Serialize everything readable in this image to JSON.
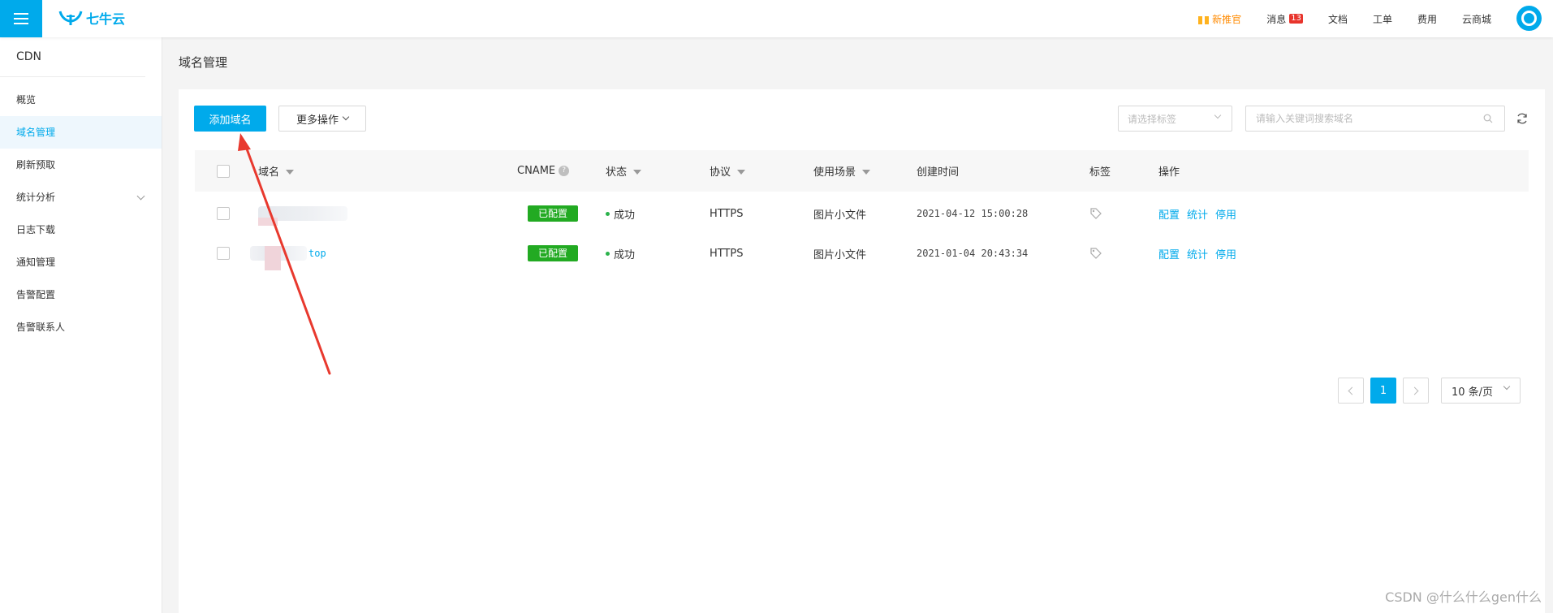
{
  "header": {
    "logo_text": "七牛云",
    "nav": [
      {
        "label": "新推官",
        "icon": "gift-icon"
      },
      {
        "label": "消息",
        "badge": "13"
      },
      {
        "label": "文档"
      },
      {
        "label": "工单"
      },
      {
        "label": "费用"
      },
      {
        "label": "云商城"
      }
    ]
  },
  "sidebar": {
    "title": "CDN",
    "items": [
      {
        "label": "概览"
      },
      {
        "label": "域名管理",
        "active": true
      },
      {
        "label": "刷新预取"
      },
      {
        "label": "统计分析",
        "expandable": true
      },
      {
        "label": "日志下载"
      },
      {
        "label": "通知管理"
      },
      {
        "label": "告警配置"
      },
      {
        "label": "告警联系人"
      }
    ]
  },
  "main": {
    "page_title": "域名管理",
    "toolbar": {
      "add_label": "添加域名",
      "more_label": "更多操作",
      "tag_placeholder": "请选择标签",
      "search_placeholder": "请输入关键词搜索域名"
    },
    "table": {
      "columns": {
        "domain": "域名",
        "cname": "CNAME",
        "status": "状态",
        "protocol": "协议",
        "scene": "使用场景",
        "created": "创建时间",
        "tags": "标签",
        "actions": "操作"
      },
      "rows": [
        {
          "domain_suffix": "",
          "cname": "已配置",
          "status": "成功",
          "protocol": "HTTPS",
          "scene": "图片小文件",
          "created": "2021-04-12 15:00:28",
          "actions": [
            "配置",
            "统计",
            "停用"
          ]
        },
        {
          "domain_suffix": "top",
          "cname": "已配置",
          "status": "成功",
          "protocol": "HTTPS",
          "scene": "图片小文件",
          "created": "2021-01-04 20:43:34",
          "actions": [
            "配置",
            "统计",
            "停用"
          ]
        }
      ]
    },
    "pagination": {
      "current": "1",
      "page_size": "10 条/页"
    }
  },
  "watermark": "CSDN @什么什么gen什么",
  "colors": {
    "accent": "#00aaeb",
    "success": "#22aa22",
    "annotation": "#e8392e"
  }
}
